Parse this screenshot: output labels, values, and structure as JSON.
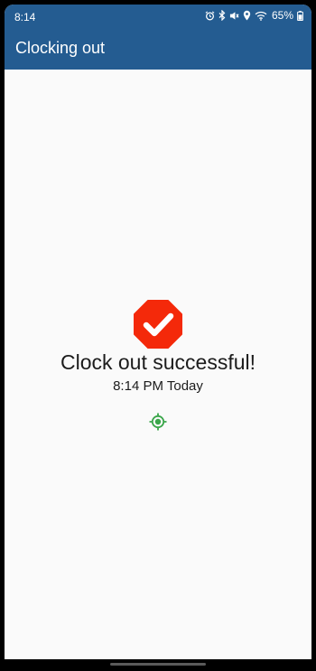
{
  "status_bar": {
    "time": "8:14",
    "battery_percent": "65%",
    "icons": [
      "alarm-icon",
      "bluetooth-icon",
      "mute-icon",
      "location-pin-icon",
      "wifi-icon",
      "battery-icon"
    ]
  },
  "app_bar": {
    "title": "Clocking out"
  },
  "result": {
    "message": "Clock out successful!",
    "time": "8:14 PM Today",
    "icon": "checkmark-octagon-icon",
    "icon_color": "#f4290a",
    "location_icon": "location-target-icon",
    "location_color": "#3aa64a"
  },
  "colors": {
    "primary": "#245c91",
    "background": "#fafafa"
  }
}
